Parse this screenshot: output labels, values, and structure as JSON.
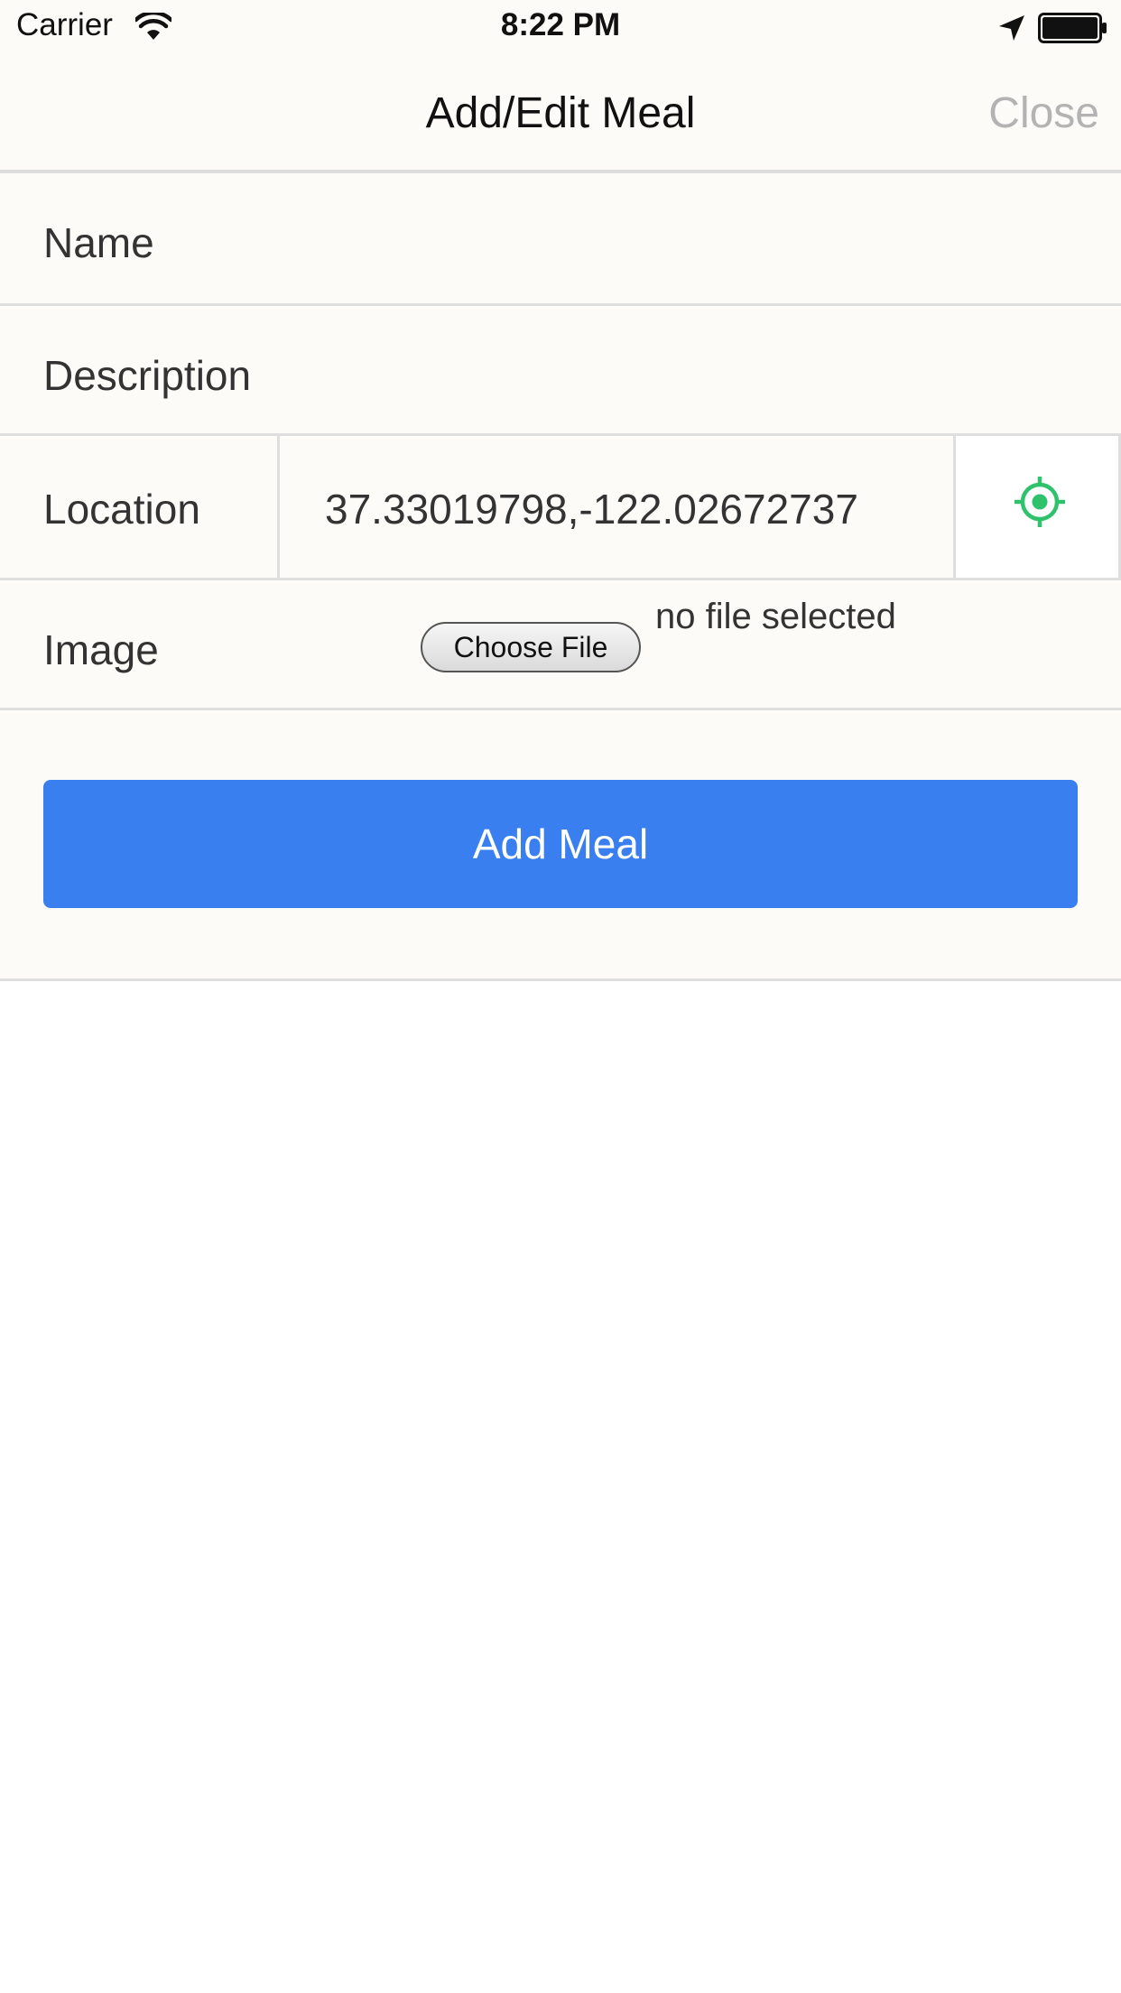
{
  "status_bar": {
    "carrier": "Carrier",
    "time": "8:22 PM"
  },
  "nav": {
    "title": "Add/Edit Meal",
    "close_label": "Close"
  },
  "form": {
    "name_label": "Name",
    "description_label": "Description",
    "location_label": "Location",
    "location_value": "37.33019798,-122.02672737",
    "image_label": "Image",
    "choose_file_label": "Choose File",
    "file_status": "no file selected",
    "submit_label": "Add Meal"
  },
  "colors": {
    "accent": "#3a7ff0",
    "locate_icon": "#2ec26a",
    "close_disabled": "#b3b3b3"
  },
  "icons": {
    "wifi": "wifi-icon",
    "location_arrow": "location-arrow-icon",
    "battery": "battery-icon",
    "locate": "target-icon"
  }
}
